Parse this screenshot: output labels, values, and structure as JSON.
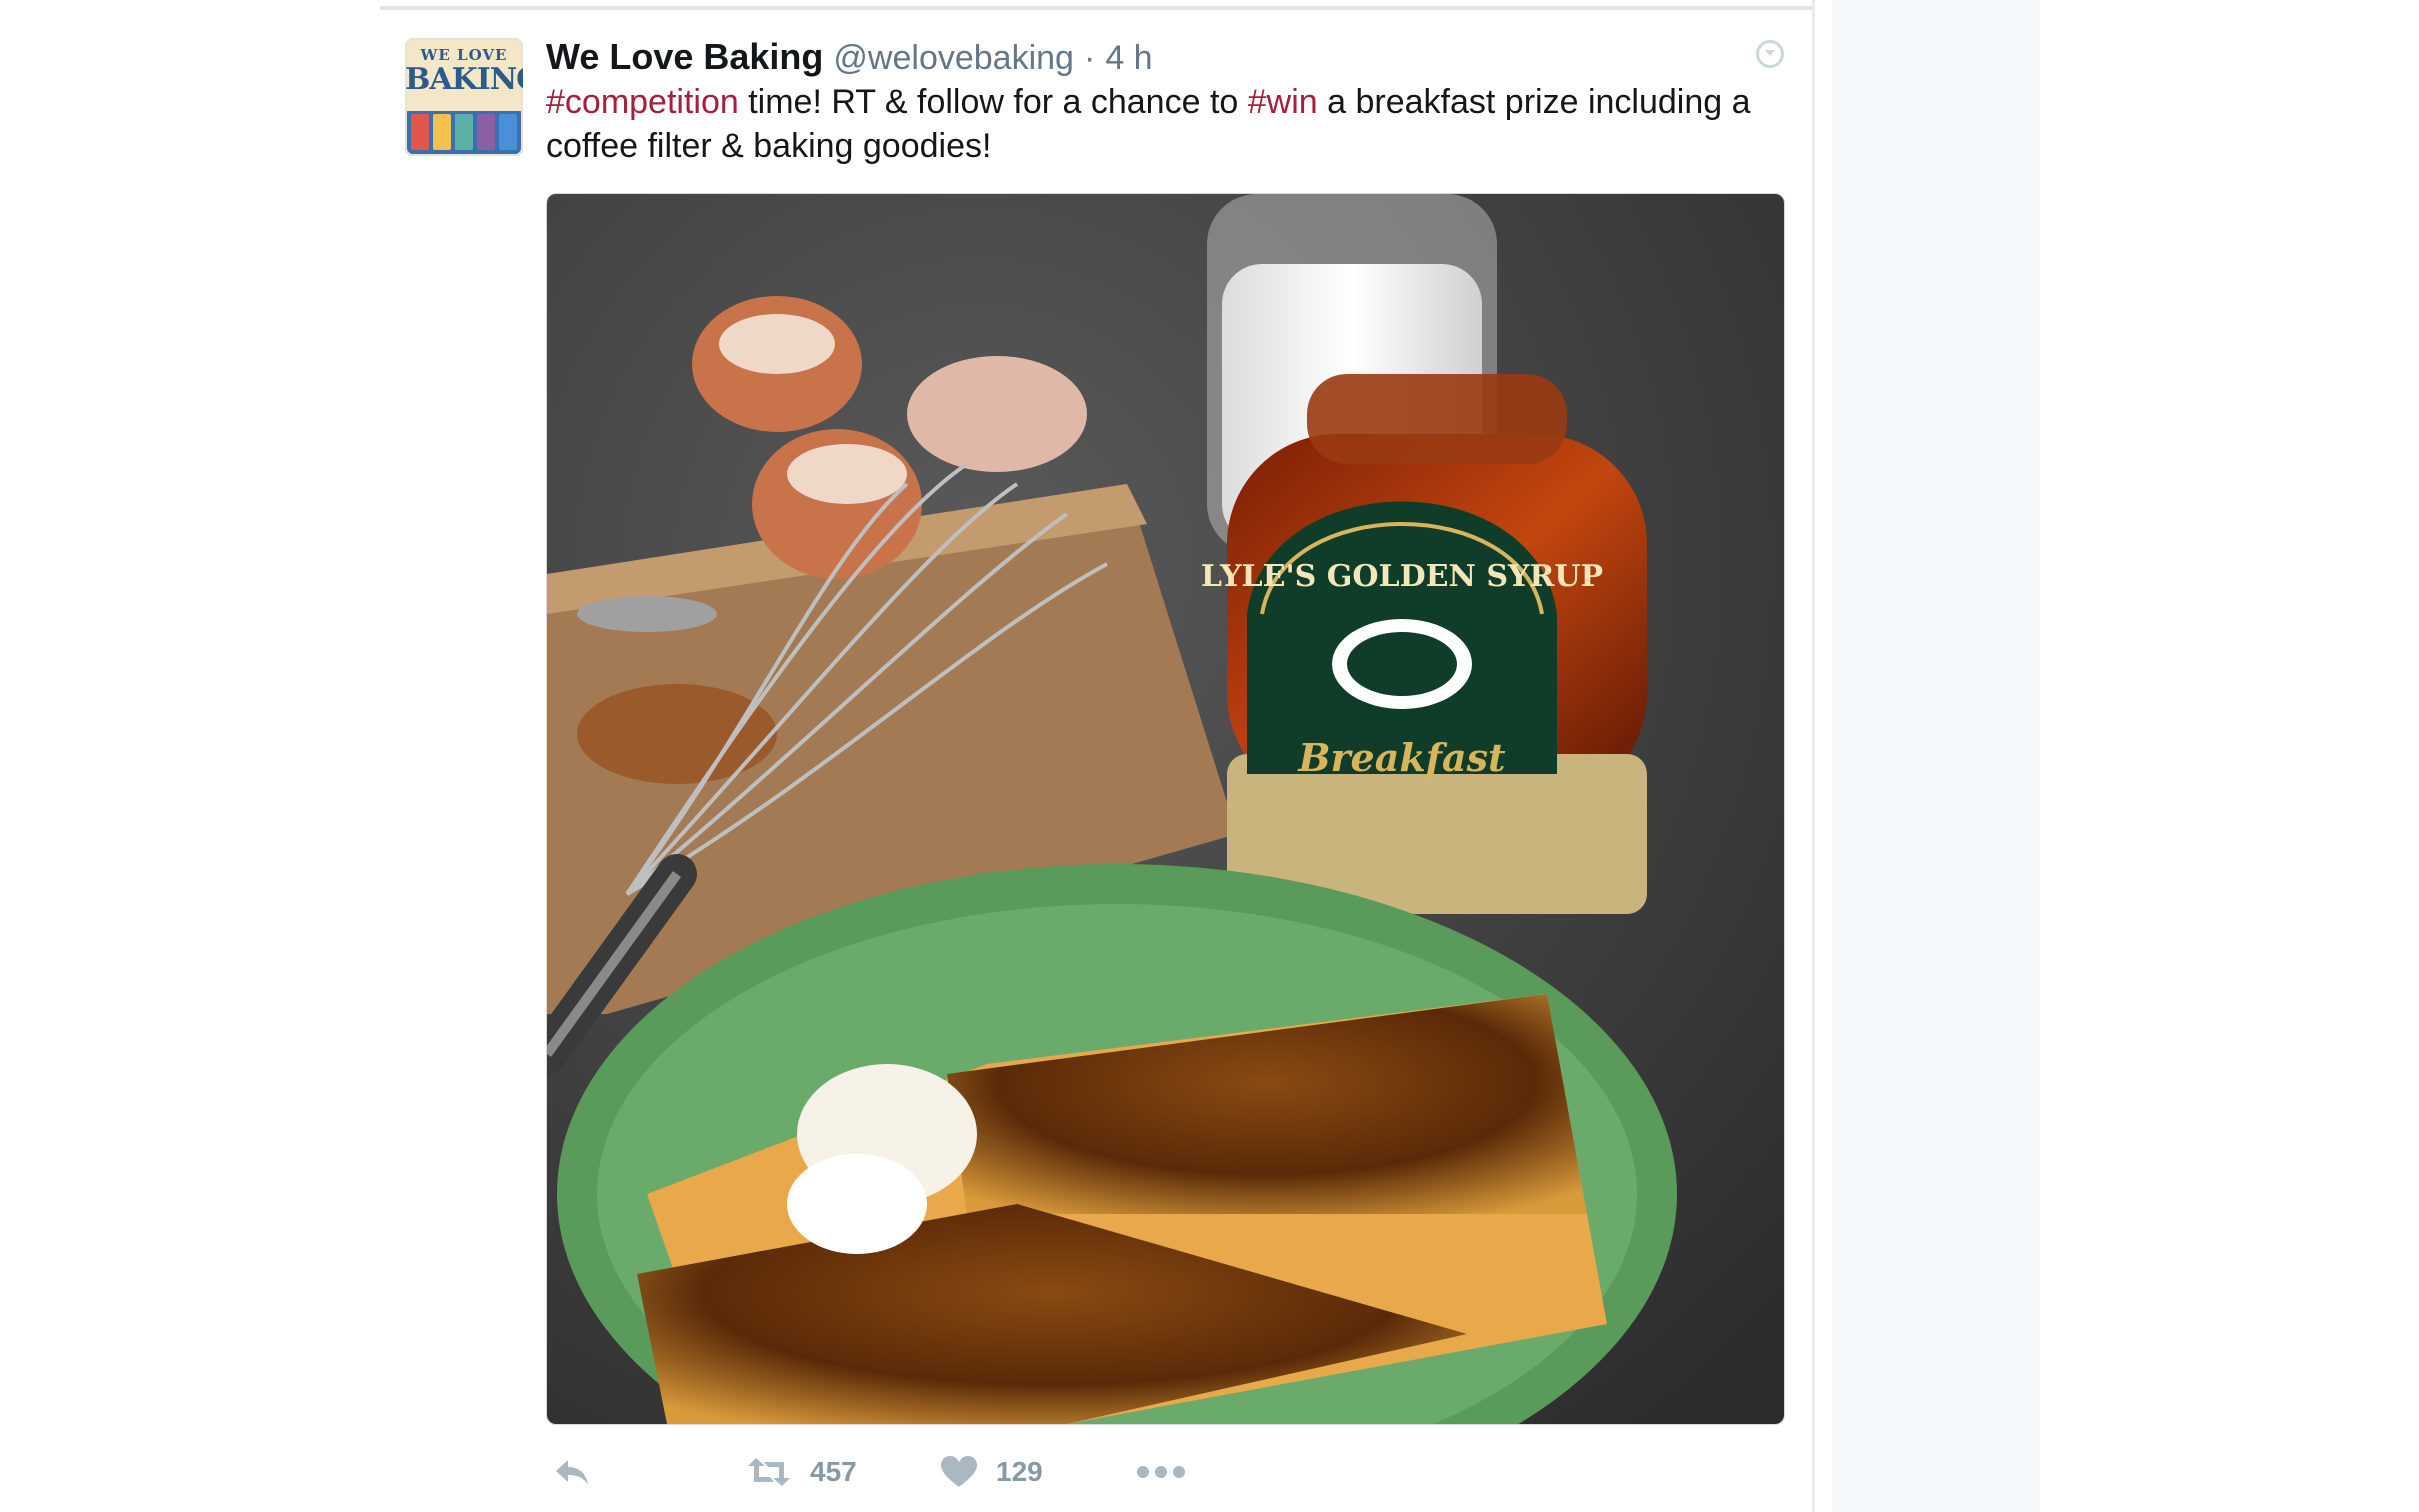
{
  "tweet": {
    "avatar_line1": "WE LOVE",
    "avatar_line2": "BAKING",
    "display_name": "We Love Baking",
    "handle": "@welovebaking",
    "separator": "·",
    "time": "4 h",
    "text_parts": {
      "tag1": "#competition",
      "mid": " time! RT & follow for a chance to ",
      "tag2": "#win",
      "end": " a breakfast prize including a coffee filter & baking goodies!"
    },
    "media_alt_visible_text": {
      "syrup_brand": "LYLE'S GOLDEN SYRUP",
      "syrup_variant": "Breakfast"
    },
    "actions": {
      "retweet_count": "457",
      "like_count": "129"
    }
  },
  "icons": {
    "reply": "reply-icon",
    "retweet": "retweet-icon",
    "like": "heart-icon",
    "more": "more-dots-icon",
    "caret": "caret-down-icon"
  },
  "colors": {
    "hashtag": "#a4203d",
    "name": "#14171a",
    "meta": "#657786",
    "action": "#8899a6",
    "sidebar": "#f5f8fa"
  }
}
